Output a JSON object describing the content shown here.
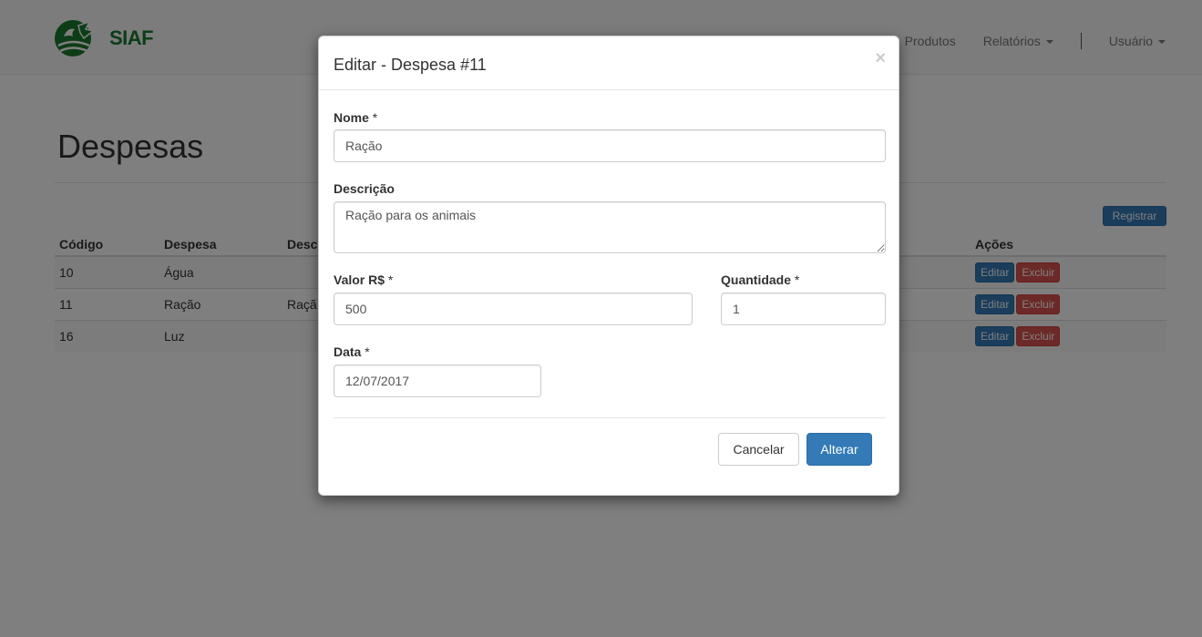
{
  "brand": {
    "name": "SIAF"
  },
  "nav": {
    "items": [
      "Produtos",
      "Relatórios",
      "Usuário"
    ]
  },
  "page": {
    "title": "Despesas"
  },
  "toolbar": {
    "register_label": "Registrar"
  },
  "table": {
    "headers": [
      "Código",
      "Despesa",
      "Desc",
      "Ações"
    ],
    "rows": [
      {
        "code": "10",
        "name": "Água",
        "desc": ""
      },
      {
        "code": "11",
        "name": "Ração",
        "desc": "Raçã"
      },
      {
        "code": "16",
        "name": "Luz",
        "desc": ""
      }
    ],
    "edit_label": "Editar",
    "delete_label": "Excluir"
  },
  "modal": {
    "title": "Editar - Despesa #11",
    "close_glyph": "×",
    "fields": {
      "name": {
        "label": "Nome",
        "required": "*",
        "value": "Ração"
      },
      "description": {
        "label": "Descrição",
        "value": "Ração para os animais"
      },
      "value": {
        "label": "Valor R$",
        "required": "*",
        "value": "500"
      },
      "quantity": {
        "label": "Quantidade",
        "required": "*",
        "value": "1"
      },
      "date": {
        "label": "Data",
        "required": "*",
        "value": "12/07/2017"
      }
    },
    "cancel_label": "Cancelar",
    "submit_label": "Alterar"
  },
  "colors": {
    "brand_green": "#1a7a2e",
    "primary": "#337ab7",
    "danger": "#d9534f"
  }
}
